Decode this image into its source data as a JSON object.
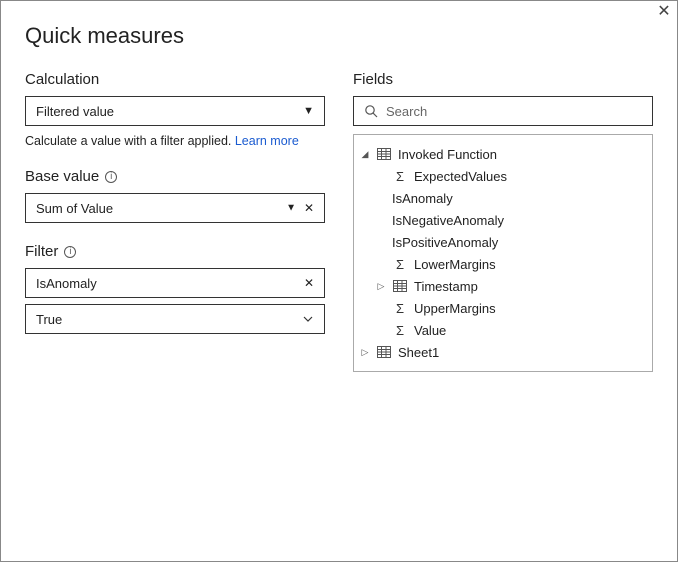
{
  "window": {
    "title": "Quick measures"
  },
  "left": {
    "calculation_label": "Calculation",
    "calculation_value": "Filtered value",
    "help_prefix": "Calculate a value with a filter applied.  ",
    "help_link": "Learn more",
    "basevalue_label": "Base value",
    "basevalue_value": "Sum of Value",
    "filter_label": "Filter",
    "filter_field": "IsAnomaly",
    "filter_value": "True"
  },
  "right": {
    "fields_label": "Fields",
    "search_placeholder": "Search",
    "tree": {
      "t0": {
        "label": "Invoked Function"
      },
      "t1": {
        "label": "ExpectedValues"
      },
      "t2": {
        "label": "IsAnomaly"
      },
      "t3": {
        "label": "IsNegativeAnomaly"
      },
      "t4": {
        "label": "IsPositiveAnomaly"
      },
      "t5": {
        "label": "LowerMargins"
      },
      "t6": {
        "label": "Timestamp"
      },
      "t7": {
        "label": "UpperMargins"
      },
      "t8": {
        "label": "Value"
      },
      "t9": {
        "label": "Sheet1"
      }
    }
  }
}
